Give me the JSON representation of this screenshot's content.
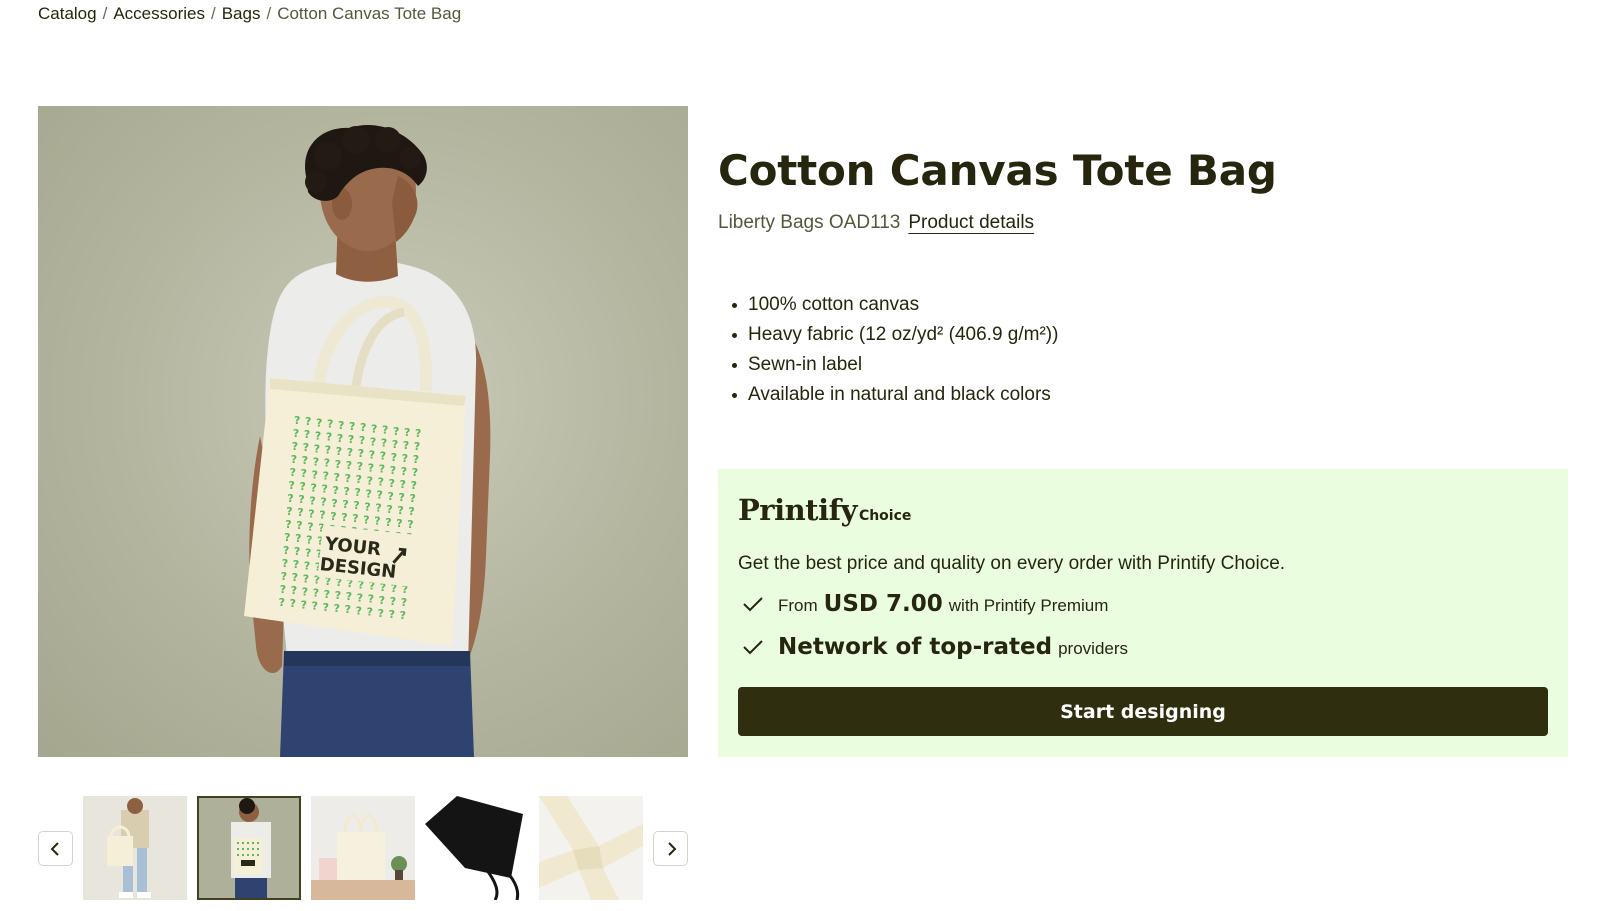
{
  "breadcrumb": {
    "items": [
      "Catalog",
      "Accessories",
      "Bags"
    ],
    "separator": "/",
    "current": "Cotton Canvas Tote Bag"
  },
  "product": {
    "title": "Cotton Canvas Tote Bag",
    "brand_code": "Liberty Bags OAD113",
    "details_link": "Product details",
    "features": [
      "100% cotton canvas",
      "Heavy fabric (12 oz/yd² (406.9 g/m²))",
      "Sewn-in label",
      "Available in natural and black colors"
    ]
  },
  "hero_image": {
    "bag_print_line1": "YOUR",
    "bag_print_line2": "DESIGN",
    "selected_thumbnail_index": 2
  },
  "gallery": {
    "prev_icon": "chevron-left-icon",
    "next_icon": "chevron-right-icon",
    "thumbnail_count": 5
  },
  "choice": {
    "logo_word": "Printify",
    "logo_sub": "Choice",
    "description": "Get the best price and quality on every order with Printify Choice.",
    "benefit1": {
      "prefix": "From",
      "price": "USD 7.00",
      "suffix": "with Printify Premium"
    },
    "benefit2": {
      "highlight": "Network of top-rated",
      "suffix": "providers"
    },
    "check_icon": "checkmark-icon",
    "cta_label": "Start designing"
  },
  "colors": {
    "text_dark": "#26260e",
    "choice_bg": "#ebfddf",
    "cta_bg": "#2f2f10",
    "hero_bg": "#b3b59f",
    "print_green": "#5cb85c"
  }
}
